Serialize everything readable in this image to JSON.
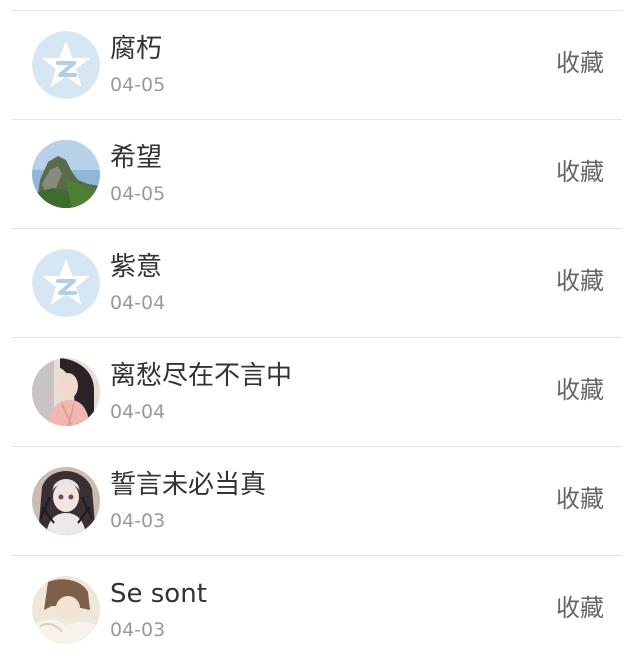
{
  "items": [
    {
      "name": "腐朽",
      "date": "04-05",
      "action": "收藏",
      "avatar": "qzone-default-icon"
    },
    {
      "name": "希望",
      "date": "04-05",
      "action": "收藏",
      "avatar": "landscape-photo"
    },
    {
      "name": "紫意",
      "date": "04-04",
      "action": "收藏",
      "avatar": "qzone-default-icon"
    },
    {
      "name": "离愁尽在不言中",
      "date": "04-04",
      "action": "收藏",
      "avatar": "girl-photo"
    },
    {
      "name": "誓言未必当真",
      "date": "04-03",
      "action": "收藏",
      "avatar": "anime-girl-photo"
    },
    {
      "name": "Se sont",
      "date": "04-03",
      "action": "收藏",
      "avatar": "girl-photo"
    }
  ],
  "colors": {
    "default_avatar_bg": "#d7e6f3",
    "divider": "#e4e4e4",
    "name_text": "#333333",
    "date_text": "#9a9a9a",
    "action_text": "#666666"
  }
}
